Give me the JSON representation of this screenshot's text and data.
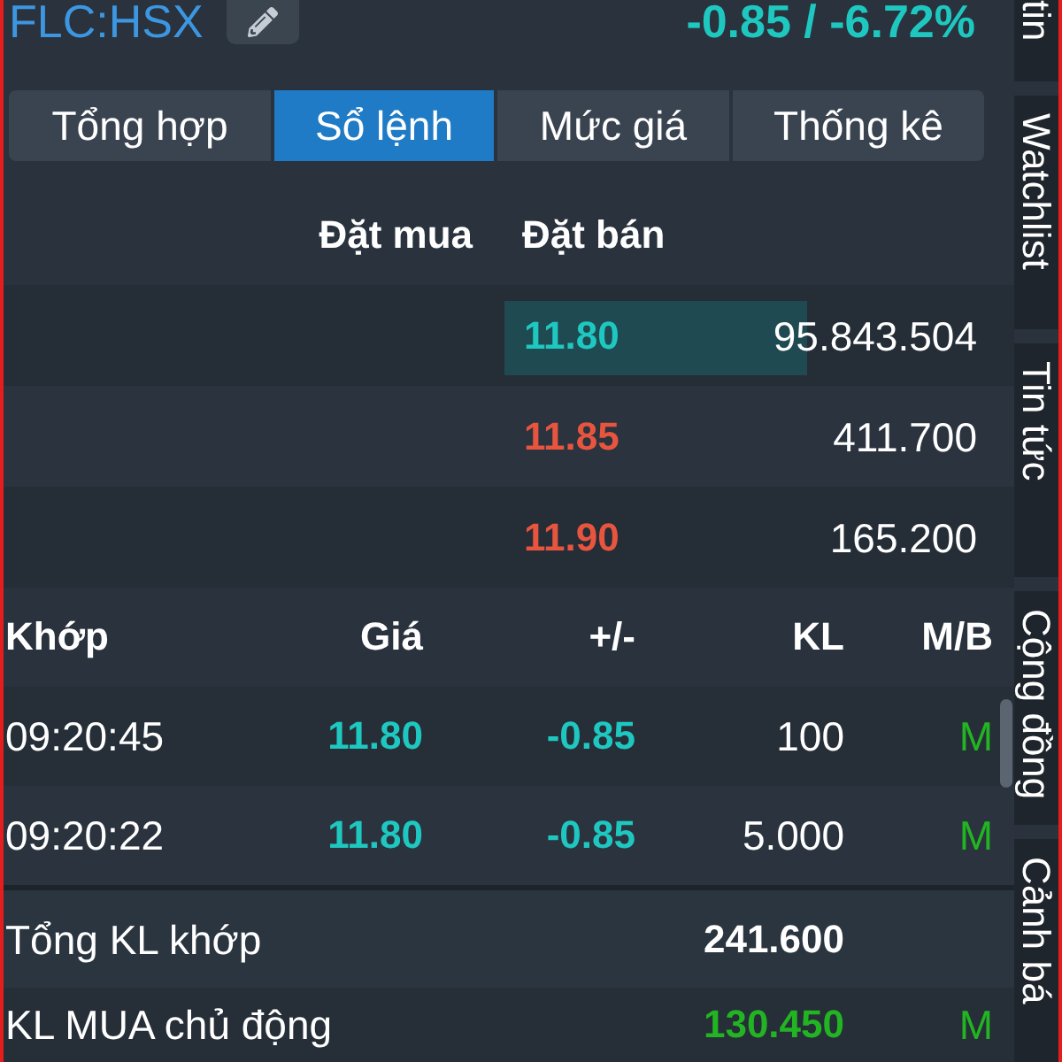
{
  "header": {
    "symbol": "FLC:HSX",
    "change": "-0.85 / -6.72%"
  },
  "tabs": [
    {
      "label": "Tổng hợp",
      "selected": false
    },
    {
      "label": "Sổ lệnh",
      "selected": true
    },
    {
      "label": "Mức giá",
      "selected": false
    },
    {
      "label": "Thống kê",
      "selected": false
    }
  ],
  "order_book": {
    "bid_heading": "Đặt mua",
    "ask_heading": "Đặt bán",
    "asks": [
      {
        "price": "11.80",
        "volume": "95.843.504",
        "color": "#1ec8c0",
        "level": 0.63
      },
      {
        "price": "11.85",
        "volume": "411.700",
        "color": "#e8553f"
      },
      {
        "price": "11.90",
        "volume": "165.200",
        "color": "#e8553f"
      }
    ]
  },
  "trades": {
    "columns": [
      "Khớp",
      "Giá",
      "+/-",
      "KL",
      "M/B"
    ],
    "rows": [
      {
        "time": "09:20:45",
        "price": "11.80",
        "change": "-0.85",
        "volume": "100",
        "side": "M",
        "kind": "buy",
        "color": "#1ec8c0"
      },
      {
        "time": "09:20:22",
        "price": "11.80",
        "change": "-0.85",
        "volume": "5.000",
        "side": "M",
        "kind": "buy",
        "color": "#1ec8c0"
      }
    ]
  },
  "summary": [
    {
      "label": "Tổng KL khớp",
      "value": "241.600",
      "kind": "total"
    },
    {
      "label": "KL MUA chủ động",
      "value": "130.450",
      "side": "M",
      "kind": "buy"
    }
  ],
  "side_tabs": [
    "tin",
    "Watchlist",
    "Tin tức",
    "Cộng đồng",
    "Cảnh bá"
  ]
}
